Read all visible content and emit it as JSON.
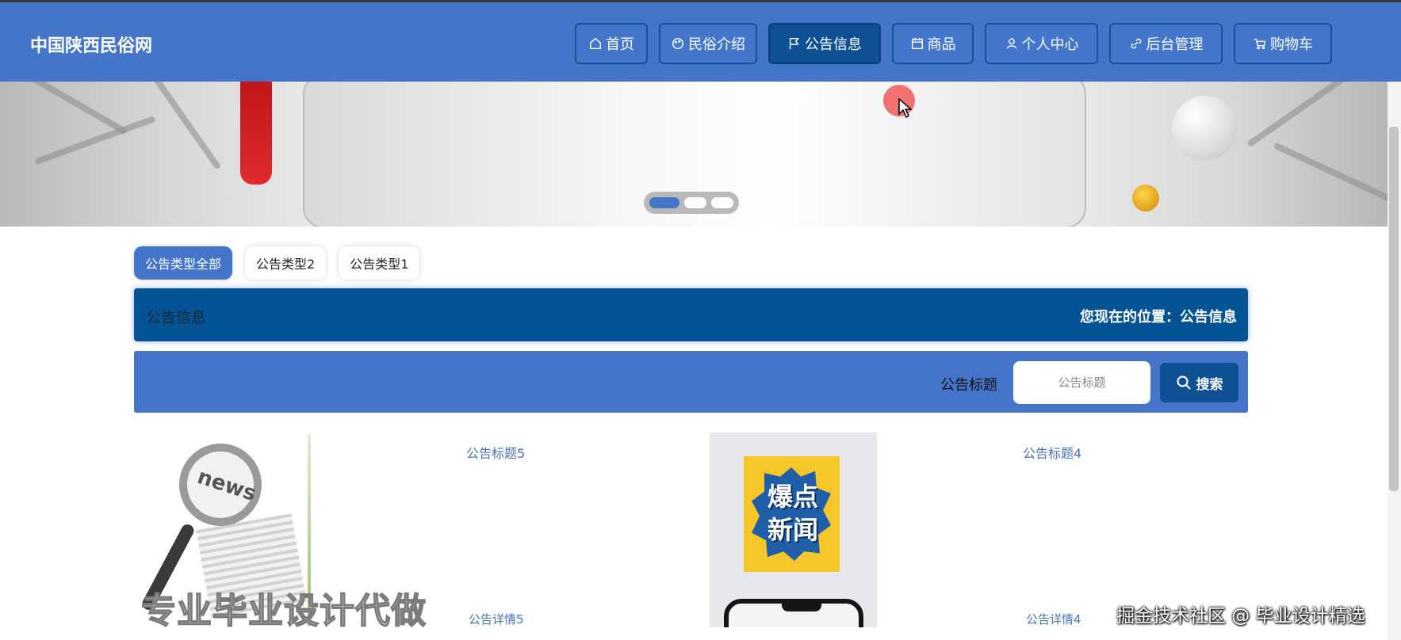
{
  "header": {
    "site_title": "中国陕西民俗网",
    "nav": [
      {
        "label": "首页",
        "icon": "home-icon",
        "active": false
      },
      {
        "label": "民俗介绍",
        "icon": "palette-icon",
        "active": false
      },
      {
        "label": "公告信息",
        "icon": "flag-icon",
        "active": true
      },
      {
        "label": "商品",
        "icon": "calendar-icon",
        "active": false
      },
      {
        "label": "个人中心",
        "icon": "user-icon",
        "active": false
      },
      {
        "label": "后台管理",
        "icon": "link-icon",
        "active": false
      },
      {
        "label": "购物车",
        "icon": "cart-icon",
        "active": false
      }
    ]
  },
  "banner": {
    "slides_total": 3,
    "active_slide": 1
  },
  "filters": {
    "chips": [
      {
        "label": "公告类型全部",
        "active": true
      },
      {
        "label": "公告类型2",
        "active": false
      },
      {
        "label": "公告类型1",
        "active": false
      }
    ]
  },
  "info_bar": {
    "title": "公告信息",
    "breadcrumb": "您现在的位置：公告信息"
  },
  "search": {
    "label": "公告标题",
    "placeholder": "公告标题",
    "button_label": "搜索"
  },
  "cards": [
    {
      "image_text": "news",
      "title": "公告标题5",
      "detail": "公告详情5"
    },
    {
      "image_text": "爆点新闻",
      "title": "公告标题4",
      "detail": "公告详情4"
    }
  ],
  "watermarks": {
    "left": "专业毕业设计代做",
    "right": "掘金技术社区 @ 毕业设计精选"
  },
  "colors": {
    "primary": "#4475c9",
    "dark_primary": "#045394",
    "link": "#4a73b2"
  }
}
